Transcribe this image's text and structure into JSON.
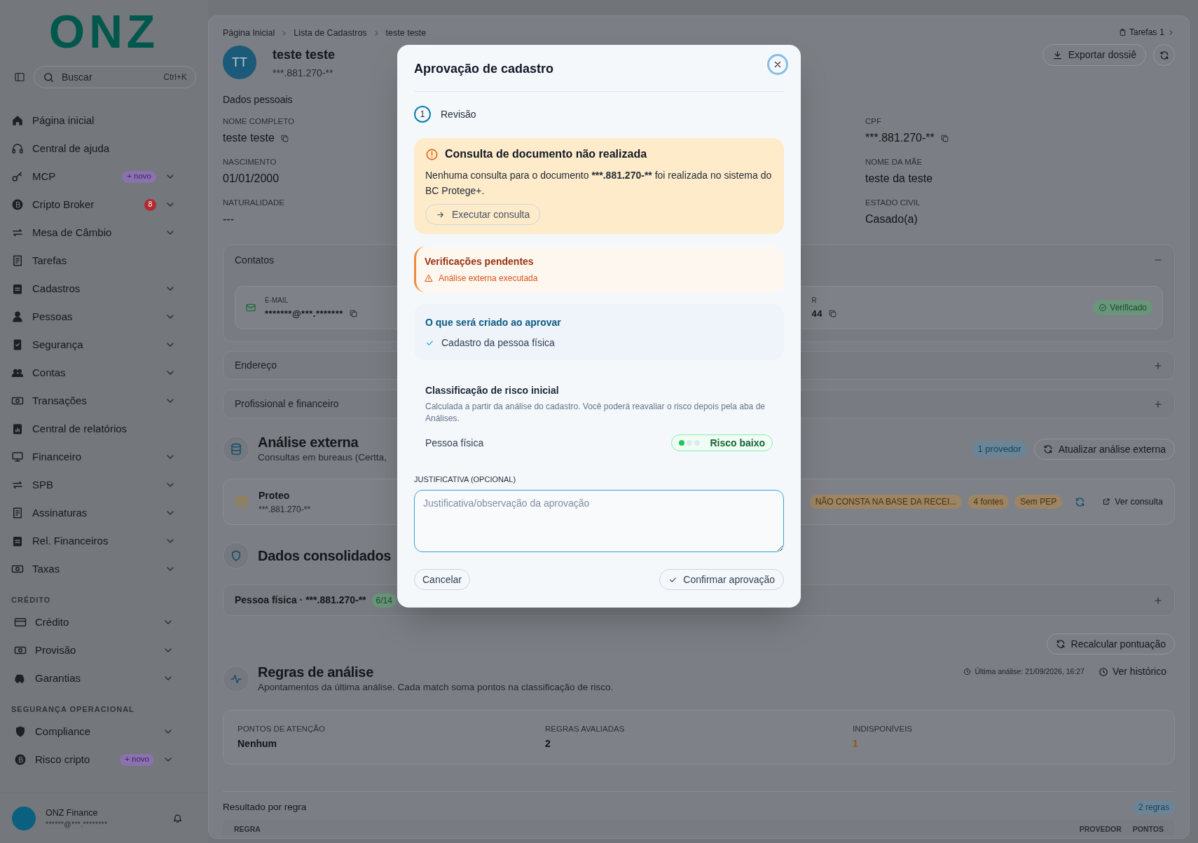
{
  "sidebar": {
    "logo": "ONZ",
    "search": {
      "placeholder": "Buscar",
      "shortcut": "Ctrl+K"
    },
    "items": [
      {
        "label": "Página inicial",
        "expandable": false
      },
      {
        "label": "Central de ajuda",
        "expandable": false
      },
      {
        "label": "MCP",
        "badge": {
          "kind": "new",
          "text": "+ novo"
        },
        "expandable": true
      },
      {
        "label": "Cripto Broker",
        "badge": {
          "kind": "count",
          "text": "8"
        },
        "expandable": true
      },
      {
        "label": "Mesa de Câmbio",
        "expandable": true
      },
      {
        "label": "Tarefas",
        "expandable": false
      },
      {
        "label": "Cadastros",
        "expandable": true
      },
      {
        "label": "Pessoas",
        "expandable": true
      },
      {
        "label": "Segurança",
        "expandable": true
      },
      {
        "label": "Contas",
        "expandable": true
      },
      {
        "label": "Transações",
        "expandable": true
      },
      {
        "label": "Central de relatórios",
        "expandable": false
      },
      {
        "label": "Financeiro",
        "expandable": true
      },
      {
        "label": "SPB",
        "expandable": true
      },
      {
        "label": "Assinaturas",
        "expandable": true
      },
      {
        "label": "Rel. Financeiros",
        "expandable": true
      },
      {
        "label": "Taxas",
        "expandable": true
      }
    ],
    "sections": [
      {
        "title": "CRÉDITO",
        "items": [
          {
            "label": "Crédito",
            "expandable": true
          },
          {
            "label": "Provisão",
            "expandable": true
          },
          {
            "label": "Garantias",
            "expandable": true
          }
        ]
      },
      {
        "title": "SEGURANÇA OPERACIONAL",
        "items": [
          {
            "label": "Compliance",
            "expandable": true
          },
          {
            "label": "Risco cripto",
            "badge": {
              "kind": "new",
              "text": "+ novo"
            },
            "expandable": true
          }
        ]
      }
    ],
    "user": {
      "name": "ONZ Finance",
      "email": "******@***.********"
    }
  },
  "header": {
    "breadcrumb": [
      "Página Inicial",
      "Lista de Cadastros",
      "teste teste"
    ],
    "tasks": {
      "label": "Tarefas",
      "count": "1"
    },
    "avatar": "TT",
    "name": "teste teste",
    "document": "***.881.270-**",
    "export_button": "Exportar dossiê"
  },
  "personal": {
    "title": "Dados pessoais",
    "columns": [
      [
        {
          "label": "NOME COMPLETO",
          "value": "teste teste",
          "copyable": true
        },
        {
          "label": "NASCIMENTO",
          "value": "01/01/2000",
          "copyable": false
        },
        {
          "label": "NATURALIDADE",
          "value": "---",
          "copyable": false
        }
      ],
      [
        {
          "label": "CPF",
          "value": "***.881.270-**",
          "copyable": true
        },
        {
          "label": "NOME DA MÃE",
          "value": "teste da teste",
          "copyable": false
        },
        {
          "label": "ESTADO CIVIL",
          "value": "Casado(a)",
          "copyable": false
        }
      ]
    ]
  },
  "contacts": {
    "title": "Contatos",
    "expanded": true,
    "cards": [
      {
        "label": "E-MAIL",
        "value": "*******@***.*******"
      },
      {
        "label": "R",
        "value": "44",
        "status": "Verificado"
      }
    ]
  },
  "collapsed_sections": [
    {
      "title": "Endereço",
      "expanded": false
    },
    {
      "title": "Profissional e financeiro",
      "expanded": false
    }
  ],
  "external_analysis": {
    "title": "Análise externa",
    "subtitle": "Consultas em bureaus (Certta,",
    "provider_count": "1 provedor",
    "update_button": "Atualizar análise externa",
    "providers": [
      {
        "name": "Proteo",
        "document": "***.881.270-**",
        "tags": [
          "NÃO CONSTA NA BASE DA RECEI...",
          "4 fontes",
          "Sem PEP"
        ],
        "link": "Ver consulta"
      }
    ]
  },
  "consolidated": {
    "title": "Dados consolidados",
    "entities": [
      {
        "label": "Pessoa física · ***.881.270-**",
        "count": "6/14",
        "expanded": false
      }
    ]
  },
  "rules": {
    "recalc_button": "Recalcular pontuação",
    "title": "Regras de análise",
    "subtitle": "Apontamentos da última análise. Cada match soma pontos na classificação de risco.",
    "last_analysis": "Última análise: 21/09/2026, 16:27",
    "history_button": "Ver histórico",
    "stats": [
      {
        "label": "PONTOS DE ATENÇÃO",
        "value": "Nenhum",
        "kind": "plain"
      },
      {
        "label": "REGRAS AVALIADAS",
        "value": "2",
        "kind": "plain"
      },
      {
        "label": "INDISPONÍVEIS",
        "value": "1",
        "kind": "warning"
      }
    ],
    "results_title": "Resultado por regra",
    "results_count": "2 regras",
    "columns": [
      "REGRA",
      "PROVEDOR",
      "PONTOS"
    ]
  },
  "modal": {
    "title": "Aprovação de cadastro",
    "steps": [
      {
        "number": "1",
        "label": "Revisão",
        "selected": true
      }
    ],
    "alert": {
      "title": "Consulta de documento não realizada",
      "text": [
        {
          "text": "Nenhuma consulta para o documento ",
          "bold": false
        },
        {
          "text": "***.881.270-**",
          "bold": true
        },
        {
          "text": " foi realizada no sistema do BC Protege+.",
          "bold": false
        }
      ],
      "action": "Executar consulta"
    },
    "pending": {
      "title": "Verificações pendentes",
      "items": [
        "Análise externa executada"
      ]
    },
    "creates": {
      "title": "O que será criado ao aprovar",
      "items": [
        "Cadastro da pessoa física"
      ]
    },
    "risk": {
      "title": "Classificação de risco inicial",
      "description": "Calculada a partir da análise do cadastro. Você poderá reavaliar o risco depois pela aba de Análises.",
      "entity": "Pessoa física",
      "label": "Risco baixo",
      "level": 0.33
    },
    "justification": {
      "label": "JUSTIFICATIVA (OPCIONAL)",
      "placeholder": "Justificativa/observação da aprovação"
    },
    "cancel": "Cancelar",
    "confirm": "Confirmar aprovação"
  }
}
